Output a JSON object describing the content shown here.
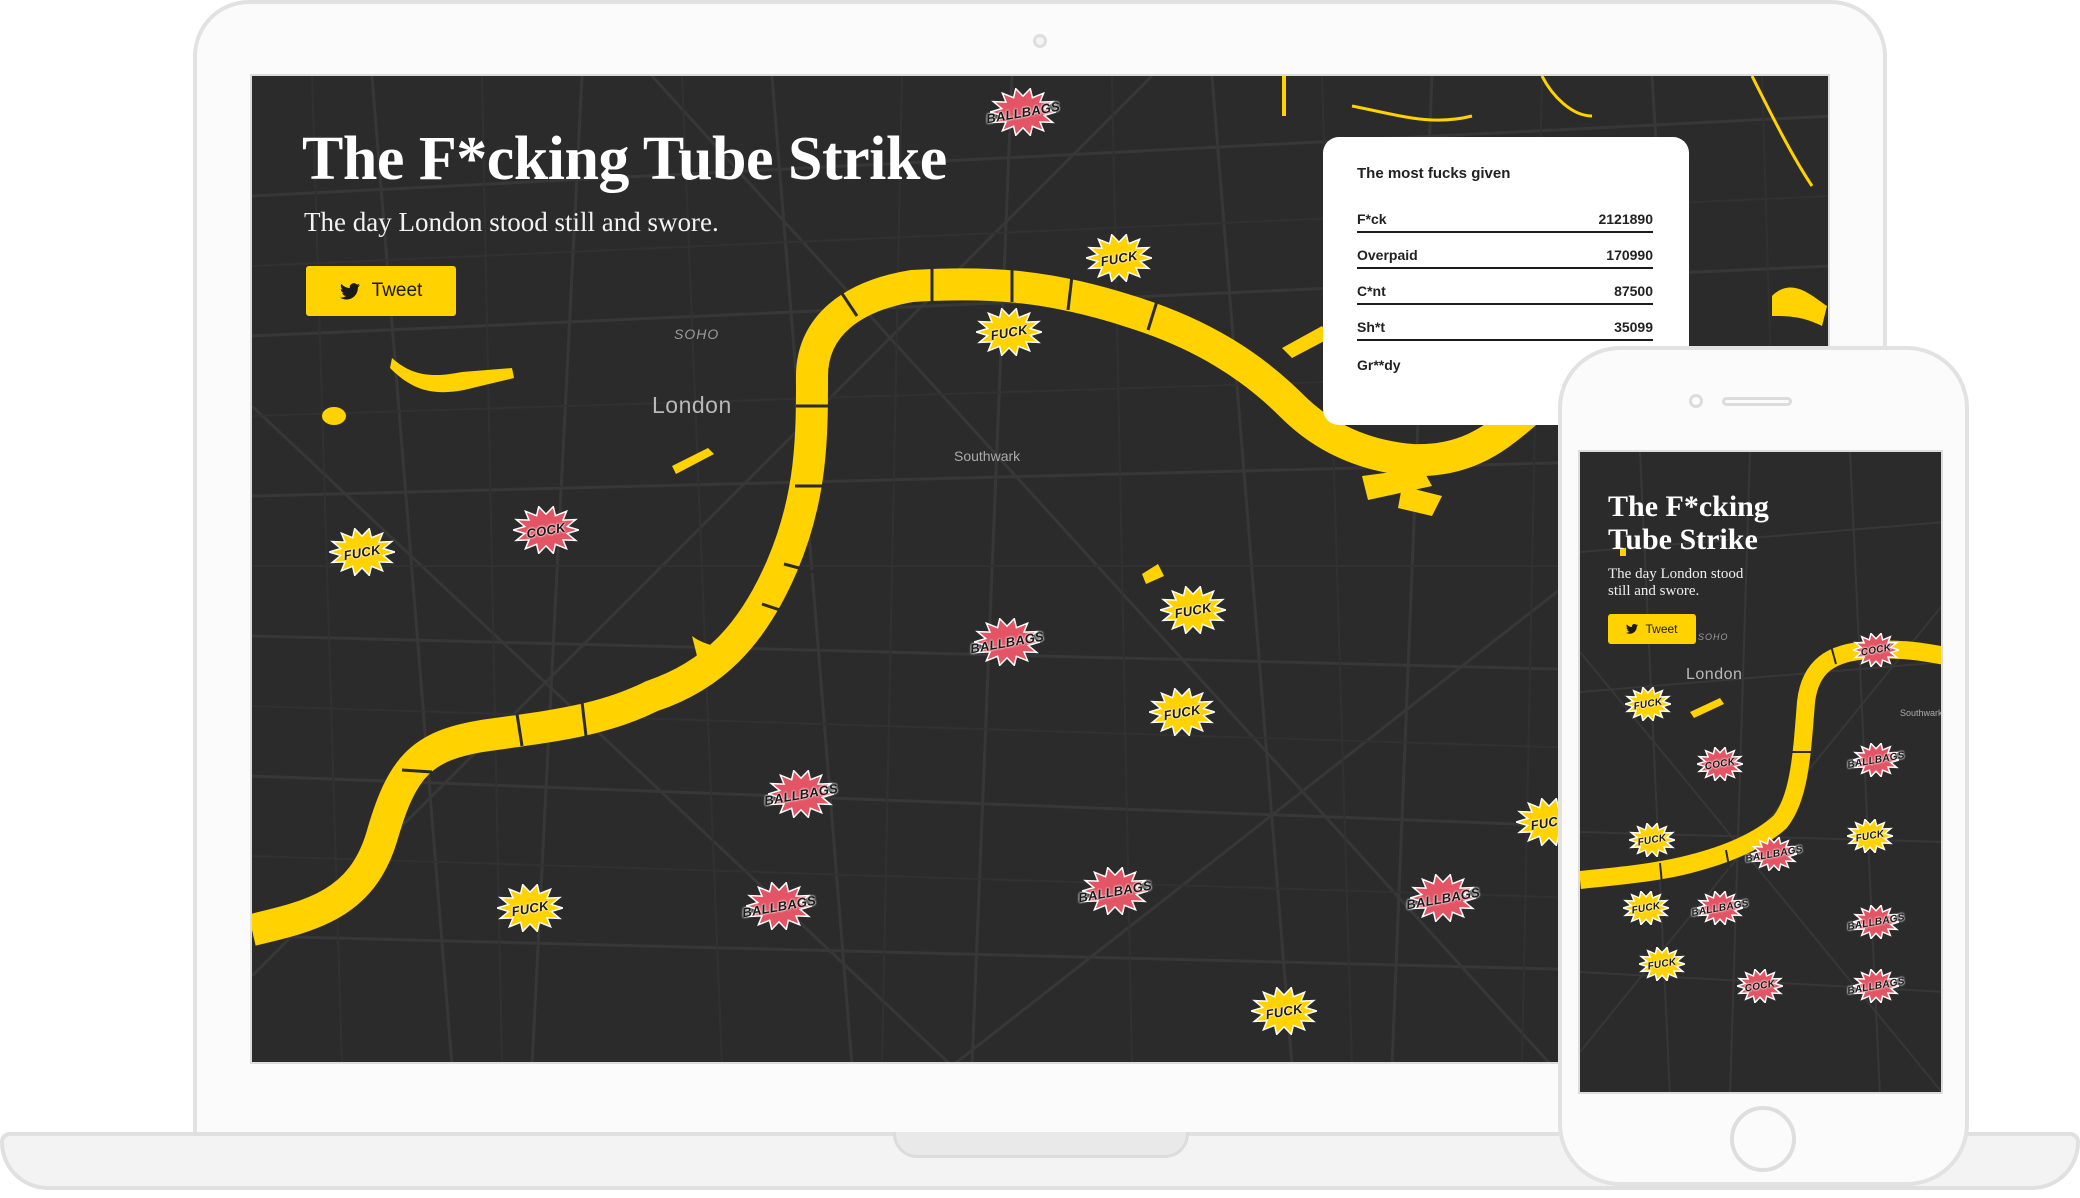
{
  "page": {
    "title": "The F*cking Tube Strike",
    "subtitle": "The day London stood still and swore.",
    "tweet_label": "Tweet"
  },
  "legend": {
    "title": "The most fucks given",
    "rows": [
      {
        "word": "F*ck",
        "count": "2121890"
      },
      {
        "word": "Overpaid",
        "count": "170990"
      },
      {
        "word": "C*nt",
        "count": "87500"
      },
      {
        "word": "Sh*t",
        "count": "35099"
      },
      {
        "word": "Gr**dy",
        "count": ""
      }
    ]
  },
  "map": {
    "city_label": "London",
    "area_labels": {
      "soho": "SOHO",
      "southwark": "Southwark"
    }
  },
  "mobile": {
    "title": "The F*cking Tube Strike",
    "subtitle": "The day London stood still and swore.",
    "tweet_label": "Tweet",
    "city_label": "London",
    "soho": "SOHO",
    "southwark": "Southwark"
  },
  "bursts": [
    {
      "word": "BALLBAGS",
      "color": "#e35565"
    },
    {
      "word": "FUCK",
      "color": "#ffd200"
    },
    {
      "word": "COCK",
      "color": "#e35565"
    }
  ],
  "colors": {
    "river": "#ffd200",
    "map_background": "#2b2b2b",
    "accent": "#ffd200",
    "burst_red": "#e35565",
    "burst_yellow": "#ffd200"
  },
  "icons": [
    "twitter-bird-icon"
  ]
}
